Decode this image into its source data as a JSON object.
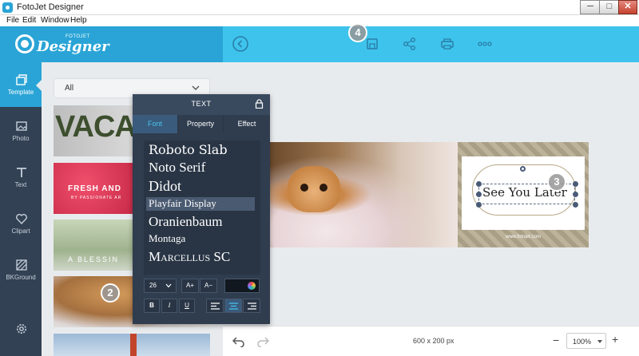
{
  "window": {
    "title": "FotoJet Designer",
    "min_glyph": "─",
    "max_glyph": "□",
    "close_glyph": "✕"
  },
  "menu": [
    "File",
    "Edit",
    "Window",
    "Help"
  ],
  "logo": {
    "word": "Designer",
    "small": "FOTOJET"
  },
  "toolbar": {
    "icons": [
      "back-icon",
      "save-icon",
      "share-icon",
      "print-icon",
      "more-icon"
    ]
  },
  "nav": [
    {
      "label": "Template",
      "icon": "template-icon",
      "active": true
    },
    {
      "label": "Photo",
      "icon": "photo-icon",
      "active": false
    },
    {
      "label": "Text",
      "icon": "text-icon",
      "active": false
    },
    {
      "label": "Clipart",
      "icon": "clipart-icon",
      "active": false
    },
    {
      "label": "BKGround",
      "icon": "background-icon",
      "active": false
    },
    {
      "label": "",
      "icon": "settings-icon",
      "active": false
    }
  ],
  "template_panel": {
    "category": "All",
    "thumbs": {
      "t1": "VACA",
      "t2": "FRESH AND",
      "t2_sub": "BY PASSIONATE AR",
      "t3": "A BLESSIN"
    }
  },
  "text_panel": {
    "title": "TEXT",
    "tabs": [
      {
        "label": "Font",
        "active": true
      },
      {
        "label": "Property",
        "active": false
      },
      {
        "label": "Effect",
        "active": false
      }
    ],
    "fonts": [
      "Roboto Slab",
      "Noto Serif",
      "Didot",
      "Playfair Display",
      "Oranienbaum",
      "Montaga",
      "Marcellus SC"
    ],
    "selected_font": "Playfair Display",
    "font_size": "26",
    "size_up": "A+",
    "size_down": "A−",
    "bold": "B",
    "italic": "I",
    "underline": "U",
    "alignment": "center"
  },
  "design": {
    "card_text": "See You Later",
    "card_url": "www.fotojet.com"
  },
  "canvas": {
    "size_label": "600 x 200 px",
    "zoom": "100%"
  },
  "badges": [
    "2",
    "3",
    "4"
  ],
  "colors": {
    "accent": "#2aa4d6",
    "toolbar": "#3ec4ec",
    "nav_bg": "#324154",
    "panel_bg": "#2f3d4f"
  }
}
